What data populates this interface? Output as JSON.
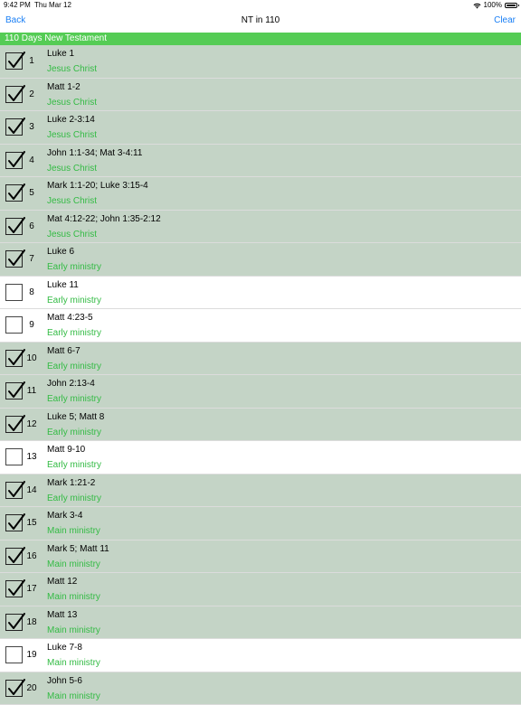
{
  "status_bar": {
    "time": "9:42 PM",
    "date": "Thu Mar 12",
    "battery": "100%"
  },
  "nav": {
    "back_label": "Back",
    "title": "NT in 110",
    "clear_label": "Clear"
  },
  "section": {
    "title": "110 Days New Testament"
  },
  "colors": {
    "accent": "#1a7ff5",
    "header_green": "#55cc55",
    "category_green": "#33bb44",
    "completed_row": "#c4d4c6"
  },
  "rows": [
    {
      "day": "1",
      "reading": "Luke 1",
      "category": "Jesus Christ",
      "checked": true
    },
    {
      "day": "2",
      "reading": "Matt 1-2",
      "category": "Jesus Christ",
      "checked": true
    },
    {
      "day": "3",
      "reading": "Luke 2-3:14",
      "category": "Jesus Christ",
      "checked": true
    },
    {
      "day": "4",
      "reading": "John 1:1-34; Mat 3-4:11",
      "category": "Jesus Christ",
      "checked": true
    },
    {
      "day": "5",
      "reading": "Mark 1:1-20; Luke 3:15-4",
      "category": "Jesus Christ",
      "checked": true
    },
    {
      "day": "6",
      "reading": "Mat 4:12-22; John 1:35-2:12",
      "category": "Jesus Christ",
      "checked": true
    },
    {
      "day": "7",
      "reading": "Luke 6",
      "category": "Early ministry",
      "checked": true
    },
    {
      "day": "8",
      "reading": "Luke 11",
      "category": "Early ministry",
      "checked": false
    },
    {
      "day": "9",
      "reading": "Matt 4:23-5",
      "category": "Early ministry",
      "checked": false
    },
    {
      "day": "10",
      "reading": "Matt 6-7",
      "category": "Early ministry",
      "checked": true
    },
    {
      "day": "11",
      "reading": "John 2:13-4",
      "category": "Early ministry",
      "checked": true
    },
    {
      "day": "12",
      "reading": "Luke 5; Matt 8",
      "category": "Early ministry",
      "checked": true
    },
    {
      "day": "13",
      "reading": "Matt 9-10",
      "category": "Early ministry",
      "checked": false
    },
    {
      "day": "14",
      "reading": "Mark 1:21-2",
      "category": "Early ministry",
      "checked": true
    },
    {
      "day": "15",
      "reading": "Mark 3-4",
      "category": "Main ministry",
      "checked": true
    },
    {
      "day": "16",
      "reading": "Mark 5; Matt 11",
      "category": "Main ministry",
      "checked": true
    },
    {
      "day": "17",
      "reading": "Matt 12",
      "category": "Main ministry",
      "checked": true
    },
    {
      "day": "18",
      "reading": "Matt 13",
      "category": "Main ministry",
      "checked": true
    },
    {
      "day": "19",
      "reading": "Luke 7-8",
      "category": "Main ministry",
      "checked": false
    },
    {
      "day": "20",
      "reading": "John 5-6",
      "category": "Main ministry",
      "checked": true
    }
  ]
}
